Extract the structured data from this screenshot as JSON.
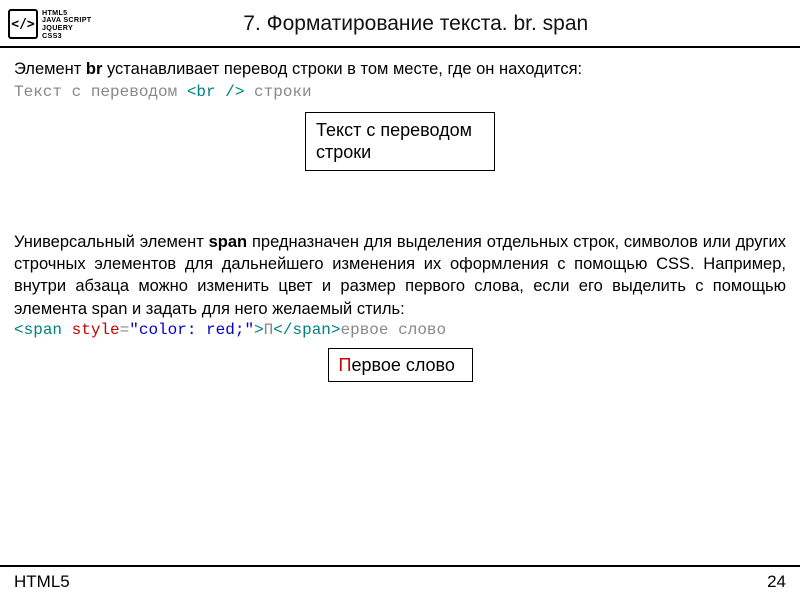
{
  "logo": {
    "icon": "</>",
    "lines": [
      "HTML5",
      "JAVA SCRIPT",
      "JQUERY",
      "CSS3"
    ]
  },
  "title": "7. Форматирование текста. br. span",
  "br_section": {
    "intro_pre": "Элемент ",
    "intro_bold": "br",
    "intro_post": " устанавливает перевод строки в том месте, где он находится:",
    "code_pre": "Текст с переводом ",
    "code_tag": "<br />",
    "code_post": " строки",
    "demo_line1": "Текст с переводом",
    "demo_line2": "строки"
  },
  "span_section": {
    "para_pre": "Универсальный элемент ",
    "para_bold": "span",
    "para_post": " предназначен для выделения отдельных строк, символов или других строчных элементов для дальнейшего изменения их оформления с помощью CSS. Например, внутри абзаца можно изменить цвет и размер первого слова, если его выделить с помощью элемента span и задать для него желаемый стиль:",
    "code_open_lt": "<",
    "code_open_tag": "span",
    "code_attr": " style",
    "code_eq": "=",
    "code_val": "\"color: red;\"",
    "code_open_gt": ">",
    "code_inner": "П",
    "code_close": "</span>",
    "code_tail": "ервое слово",
    "demo_first": "П",
    "demo_rest": "ервое слово"
  },
  "footer": {
    "left": "HTML5",
    "page": "24"
  }
}
